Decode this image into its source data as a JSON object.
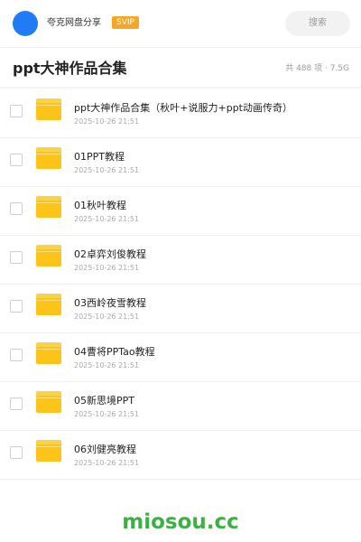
{
  "header": {
    "owner_name": "夸克网盘分享",
    "badge": "SVIP",
    "search_label": "搜索",
    "avatar_color": "#1f7cf5"
  },
  "titlebar": {
    "title": "ppt大神作品合集",
    "summary": "共 488 项 · 7.5G"
  },
  "files": [
    {
      "name": "ppt大神作品合集（秋叶+说服力+ppt动画传奇）",
      "date": "2025-10-26 21:51",
      "icon": "folder-icon"
    },
    {
      "name": "01PPT教程",
      "date": "2025-10-26 21:51",
      "icon": "folder-icon"
    },
    {
      "name": "01秋叶教程",
      "date": "2025-10-26 21:51",
      "icon": "folder-icon"
    },
    {
      "name": "02卓弈刘俊教程",
      "date": "2025-10-26 21:51",
      "icon": "folder-icon"
    },
    {
      "name": "03西岭夜雪教程",
      "date": "2025-10-26 21:51",
      "icon": "folder-icon"
    },
    {
      "name": "04曹将PPTao教程",
      "date": "2025-10-26 21:51",
      "icon": "folder-icon"
    },
    {
      "name": "05新思境PPT",
      "date": "2025-10-26 21:51",
      "icon": "folder-icon"
    },
    {
      "name": "06刘健亮教程",
      "date": "2025-10-26 21:51",
      "icon": "folder-icon"
    }
  ],
  "watermark": "miosou.cc",
  "colors": {
    "badge": "#f5a623",
    "folder": "#fcc419",
    "watermark": "#3cb043"
  }
}
